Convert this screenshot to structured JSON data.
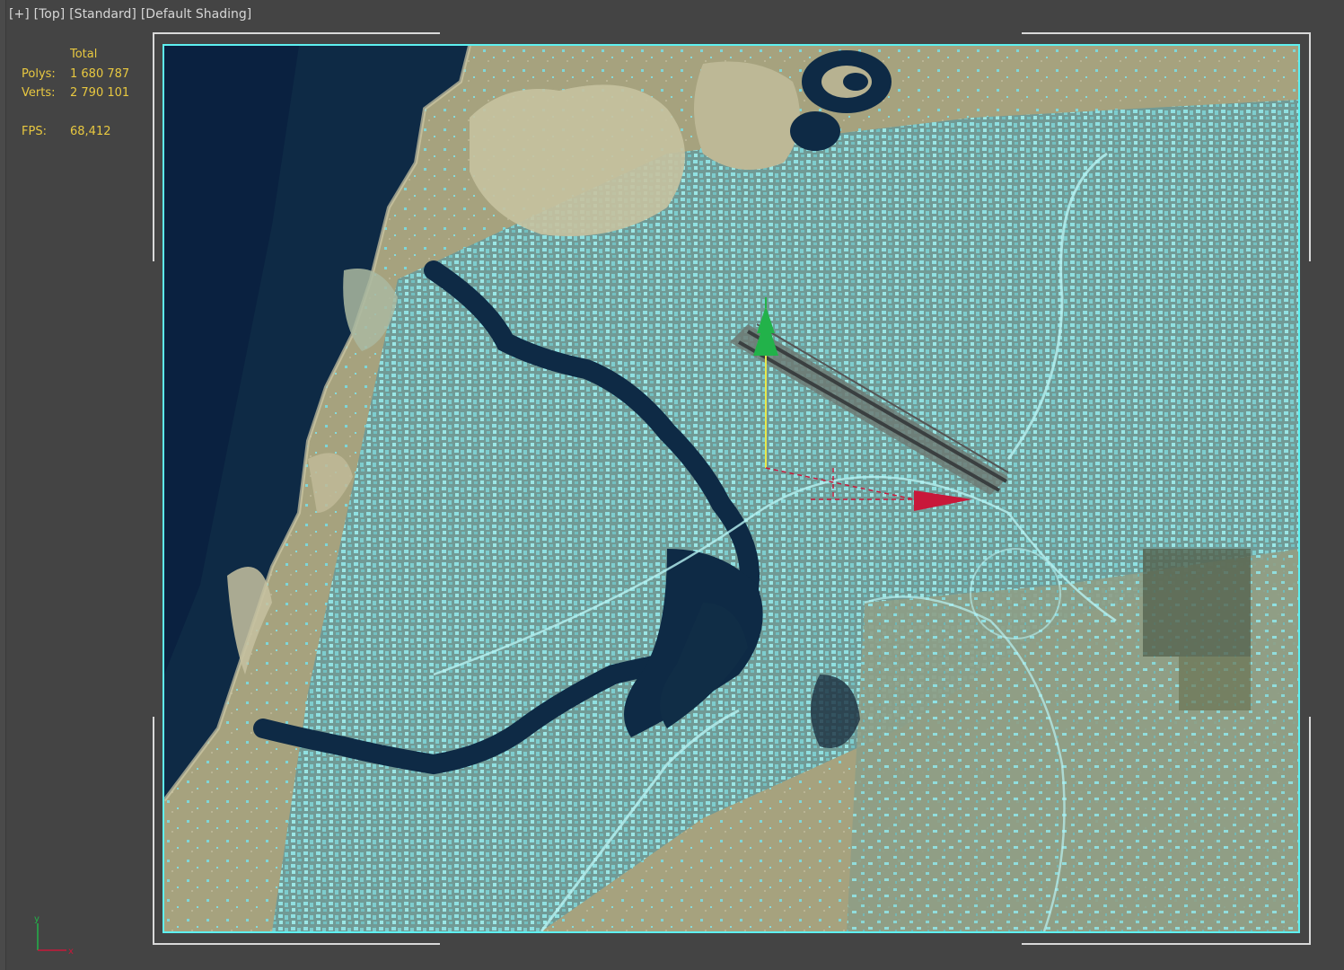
{
  "viewport": {
    "label_parts": [
      "[+]",
      "[Top]",
      "[Standard]",
      "[Default Shading]"
    ]
  },
  "stats": {
    "header": "Total",
    "polys_label": "Polys:",
    "polys_value": "1 680 787",
    "verts_label": "Verts:",
    "verts_value": "2 790 101",
    "fps_label": "FPS:",
    "fps_value": "68,412"
  },
  "colors": {
    "viewport_bg": "#444444",
    "stats_text": "#e8c840",
    "selection_wire": "#5ef0f0",
    "water": "#0e2a45",
    "land": "#a8a482",
    "urban": "#7ccfcf",
    "camera_green": "#22b24a",
    "target_red": "#c8183a"
  },
  "scene": {
    "type": "satellite-map-top-view",
    "camera_icon": "camera-icon",
    "target_icon": "camera-target-icon"
  },
  "gizmo": {
    "x_label": "x",
    "y_label": "y"
  }
}
